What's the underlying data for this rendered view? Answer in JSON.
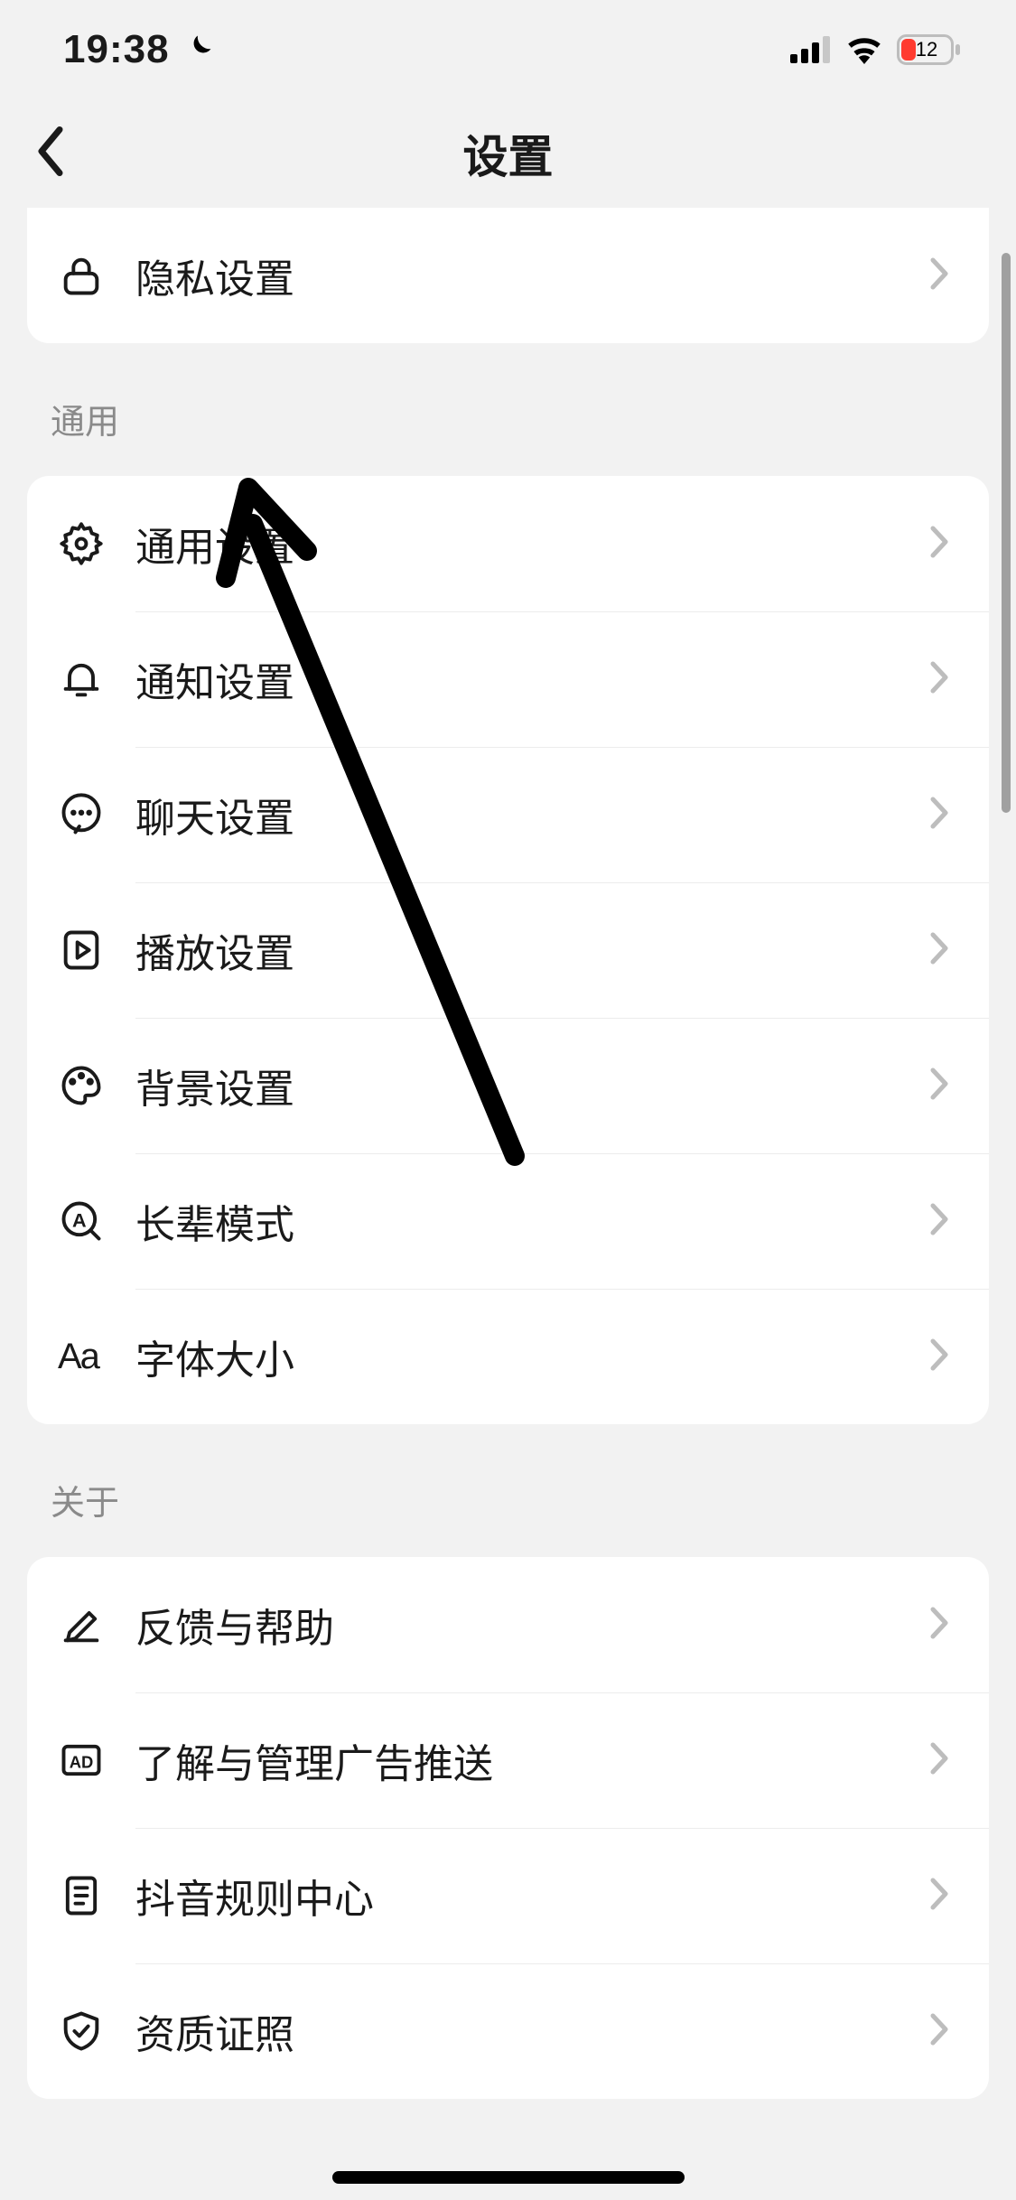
{
  "status": {
    "time": "19:38",
    "battery_percent": "12"
  },
  "nav": {
    "title": "设置"
  },
  "sections": {
    "top": {
      "items": [
        {
          "label": "隐私设置"
        }
      ]
    },
    "general": {
      "header": "通用",
      "items": [
        {
          "label": "通用设置"
        },
        {
          "label": "通知设置"
        },
        {
          "label": "聊天设置"
        },
        {
          "label": "播放设置"
        },
        {
          "label": "背景设置"
        },
        {
          "label": "长辈模式"
        },
        {
          "label": "字体大小"
        }
      ]
    },
    "about": {
      "header": "关于",
      "items": [
        {
          "label": "反馈与帮助"
        },
        {
          "label": "了解与管理广告推送"
        },
        {
          "label": "抖音规则中心"
        },
        {
          "label": "资质证照"
        }
      ]
    }
  }
}
